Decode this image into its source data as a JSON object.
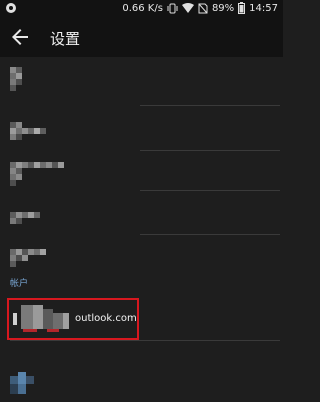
{
  "status_bar": {
    "network_speed": "0.66 K/s",
    "battery": "89%",
    "time": "14:57",
    "icons": [
      "app-notification-icon",
      "vibrate-icon",
      "wifi-icon",
      "no-sim-icon",
      "battery-icon"
    ]
  },
  "toolbar": {
    "title": "设置",
    "back_icon": "arrow-left-icon"
  },
  "sections": {
    "accounts": "帐户"
  },
  "account": {
    "email": "outlook.com",
    "highlight_color": "#d7181f"
  },
  "colors": {
    "background": "#1e1e1e",
    "accent": "#7aa8d6"
  }
}
